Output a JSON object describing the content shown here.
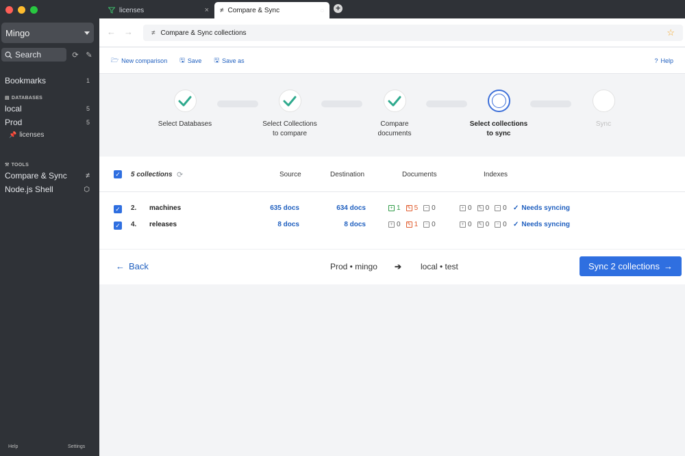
{
  "colors": {
    "accent": "#2f6fe0",
    "link": "#1f5fbf",
    "success": "#2e9a46",
    "modified": "#e05a2b",
    "sidebar_bg": "#2f3237"
  },
  "sidebar": {
    "connection": "Mingo",
    "search_placeholder": "Search",
    "bookmarks": {
      "label": "Bookmarks",
      "count": "1"
    },
    "databases_header": "DATABASES",
    "databases": [
      {
        "label": "local",
        "count": "5"
      },
      {
        "label": "Prod",
        "count": "5"
      }
    ],
    "pinned": "licenses",
    "tools_header": "TOOLS",
    "tools": [
      {
        "label": "Compare & Sync",
        "icon": "compare-icon"
      },
      {
        "label": "Node.js Shell",
        "icon": "nodejs-icon"
      }
    ],
    "footer": {
      "help": "Help",
      "settings": "Settings"
    }
  },
  "tabs": [
    {
      "label": "licenses",
      "icon": "filter-icon",
      "active": false
    },
    {
      "label": "Compare & Sync",
      "icon": "compare-icon",
      "active": true
    }
  ],
  "address": {
    "label": "Compare & Sync collections"
  },
  "toolbar": {
    "new_comparison": "New comparison",
    "save": "Save",
    "save_as": "Save as",
    "help": "Help"
  },
  "stepper": [
    {
      "label_1": "Select Databases",
      "label_2": "",
      "state": "done"
    },
    {
      "label_1": "Select Collections",
      "label_2": "to compare",
      "state": "done"
    },
    {
      "label_1": "Compare",
      "label_2": "documents",
      "state": "done"
    },
    {
      "label_1": "Select collections",
      "label_2": "to sync",
      "state": "current"
    },
    {
      "label_1": "Sync",
      "label_2": "",
      "state": "pending"
    }
  ],
  "table": {
    "summary": "5 collections",
    "headers": {
      "source": "Source",
      "destination": "Destination",
      "documents": "Documents",
      "indexes": "Indexes"
    },
    "rows": [
      {
        "num": "2.",
        "name": "machines",
        "source": "635 docs",
        "destination": "634 docs",
        "doc_added": "1",
        "doc_modified": "5",
        "doc_deleted": "0",
        "idx_added": "0",
        "idx_modified": "0",
        "idx_deleted": "0",
        "status": "Needs syncing"
      },
      {
        "num": "4.",
        "name": "releases",
        "source": "8 docs",
        "destination": "8 docs",
        "doc_added": "0",
        "doc_modified": "1",
        "doc_deleted": "0",
        "idx_added": "0",
        "idx_modified": "0",
        "idx_deleted": "0",
        "status": "Needs syncing"
      }
    ]
  },
  "footer": {
    "back": "Back",
    "source": "Prod • mingo",
    "destination": "local • test",
    "sync_button": "Sync 2 collections"
  }
}
